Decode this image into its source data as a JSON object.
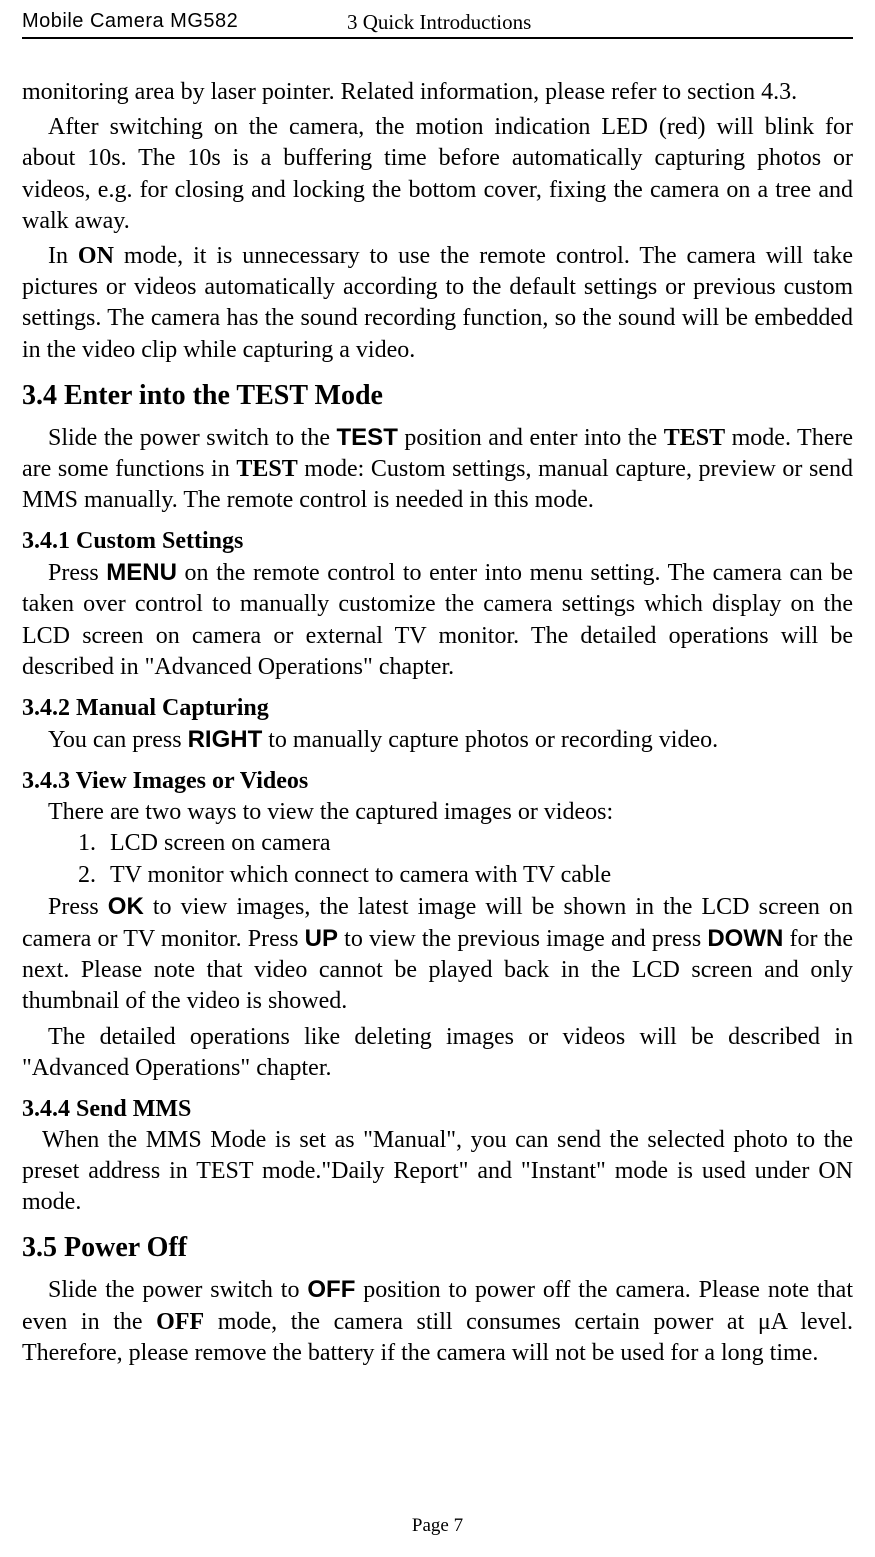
{
  "header": {
    "left": "Mobile Camera MG582",
    "right": "3 Quick Introductions"
  },
  "intro": {
    "p1": "monitoring area by laser pointer. Related information, please refer to section 4.3.",
    "p2": "After switching on the camera, the motion indication LED (red) will blink for about 10s. The 10s is a buffering time before automatically capturing photos or videos, e.g. for closing and locking the bottom cover, fixing the camera on a tree and walk away.",
    "p3_a": "In ",
    "p3_on": "ON",
    "p3_b": " mode, it is unnecessary to use the remote control. The camera will take pictures or videos automatically according to the default settings or previous custom settings. The camera has the sound recording function, so the sound will be embedded in the video clip while capturing a video."
  },
  "s34": {
    "title": "3.4  Enter into the TEST Mode",
    "p1_a": "Slide the power switch to the ",
    "p1_test1": "TEST",
    "p1_b": " position and enter into the ",
    "p1_test2": "TEST",
    "p1_c": " mode. There are some functions in ",
    "p1_test3": "TEST",
    "p1_d": " mode: Custom settings, manual capture, preview or send MMS manually. The remote control is needed in this mode."
  },
  "s341": {
    "title": "3.4.1    Custom Settings",
    "p1_a": "Press ",
    "p1_menu": "MENU",
    "p1_b": " on the remote control to enter into menu setting. The camera can be taken over control to manually customize the camera settings which display on the LCD screen on camera or external TV monitor. The detailed operations will be described in \"Advanced Operations\" chapter."
  },
  "s342": {
    "title": "3.4.2    Manual Capturing",
    "p1_a": "You can press ",
    "p1_right": "RIGHT",
    "p1_b": " to manually capture photos or recording video."
  },
  "s343": {
    "title": "3.4.3    View Images or Videos",
    "p1": "There are two ways to view the captured images or videos:",
    "li1_num": "1.",
    "li1": "LCD screen on camera",
    "li2_num": "2.",
    "li2": "TV monitor which connect to camera with TV cable",
    "p2_a": "Press ",
    "p2_ok": "OK",
    "p2_b": " to view images, the latest image will be shown in the LCD screen on camera or TV monitor. Press ",
    "p2_up": "UP",
    "p2_c": " to view the previous image and press ",
    "p2_down": "DOWN",
    "p2_d": " for the next. Please note that video cannot be played back in the LCD screen and only thumbnail of the video is showed.",
    "p3": "The detailed operations like deleting images or videos will be described in \"Advanced Operations\" chapter."
  },
  "s344": {
    "title": "3.4.4    Send MMS",
    "p1": "When the MMS Mode is set as \"Manual\", you can send the selected photo to the preset address in TEST mode.\"Daily Report\" and \"Instant\" mode is used under ON mode."
  },
  "s35": {
    "title": "3.5  Power Off",
    "p1_a": "Slide the power switch to ",
    "p1_off1": "OFF",
    "p1_b": " position to power off the camera. Please note that even in the ",
    "p1_off2": "OFF",
    "p1_c": " mode, the camera still consumes certain power at μA level. Therefore, please remove the battery if the camera will not be used for a long time."
  },
  "footer": {
    "page": "Page 7"
  }
}
